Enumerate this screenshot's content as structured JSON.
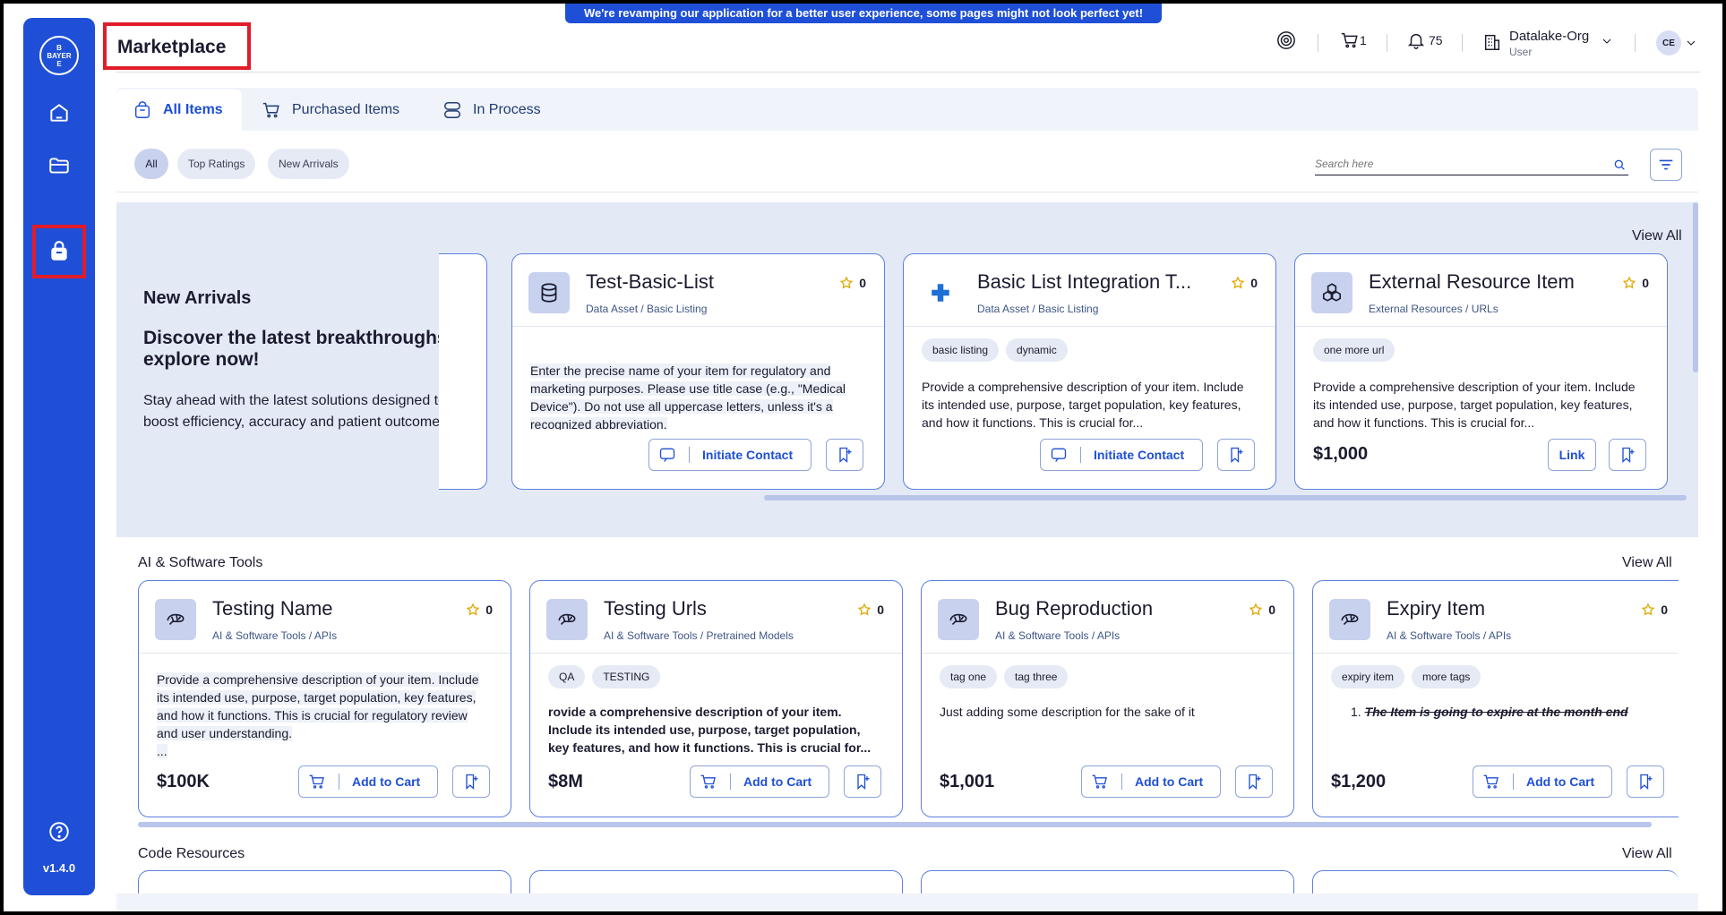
{
  "banner": "We're revamping our application for a better user experience, some pages might not look perfect yet!",
  "page_title": "Marketplace",
  "header": {
    "cart_count": "1",
    "notifications_count": "75",
    "org_name": "Datalake-Org",
    "org_role": "User",
    "avatar_initials": "CE"
  },
  "logo_text": [
    "BAYER",
    "B",
    "E"
  ],
  "sidebar_version": "v1.4.0",
  "tabs": [
    {
      "label": "All Items"
    },
    {
      "label": "Purchased Items"
    },
    {
      "label": "In Process"
    }
  ],
  "filters": {
    "chips": [
      "All",
      "Top Ratings",
      "New Arrivals"
    ],
    "search_placeholder": "Search here"
  },
  "new_arrivals": {
    "title": "New Arrivals",
    "headline": "Discover the latest breakthroughs, explore now!",
    "text": "Stay ahead with the latest solutions designed to boost efficiency, accuracy and patient outcomes.",
    "view_all": "View All",
    "cards": [
      {
        "title": "Test-Basic-List",
        "subtitle": "Data Asset / Basic Listing",
        "rating": "0",
        "description": "Enter the precise name of your item for regulatory and marketing purposes. Please use title case (e.g., \"Medical Device\"). Do not use all uppercase letters, unless it's a recognized abbreviation.",
        "action": "Initiate Contact"
      },
      {
        "title": "Basic List Integration T...",
        "subtitle": "Data Asset / Basic Listing",
        "rating": "0",
        "tags": [
          "basic listing",
          "dynamic"
        ],
        "description": "Provide a comprehensive description of your item. Include its intended use, purpose, target population, key features, and how it functions. This is crucial for...",
        "action": "Initiate Contact"
      },
      {
        "title": "External Resource Item",
        "subtitle": "External Resources / URLs",
        "rating": "0",
        "tags": [
          "one more url"
        ],
        "description": "Provide a comprehensive description of your item. Include its intended use, purpose, target population, key features, and how it functions. This is crucial for...",
        "price": "$1,000",
        "action": "Link"
      }
    ]
  },
  "ai_tools": {
    "title": "AI & Software Tools",
    "view_all": "View All",
    "cards": [
      {
        "title": "Testing Name",
        "subtitle": "AI & Software Tools / APIs",
        "rating": "0",
        "description": "Provide a comprehensive description of your item. Include its intended use, purpose, target population, key features, and how it functions. This is crucial for regulatory review and user understanding.",
        "ellipsis": "...",
        "price": "$100K",
        "action": "Add to Cart"
      },
      {
        "title": "Testing Urls",
        "subtitle": "AI & Software Tools / Pretrained Models",
        "rating": "0",
        "tags": [
          "QA",
          "TESTING"
        ],
        "description": "rovide a comprehensive description of your item. Include its intended use, purpose, target population, key features, and how it functions. This is crucial for...",
        "price": "$8M",
        "action": "Add to Cart"
      },
      {
        "title": "Bug Reproduction",
        "subtitle": "AI & Software Tools / APIs",
        "rating": "0",
        "tags": [
          "tag one",
          "tag three"
        ],
        "description": "Just adding some description for the sake of it",
        "price": "$1,001",
        "action": "Add to Cart"
      },
      {
        "title": "Expiry Item",
        "subtitle": "AI & Software Tools / APIs",
        "rating": "0",
        "tags": [
          "expiry item",
          "more tags"
        ],
        "list_item": "The Item is going to expire at the month end",
        "price": "$1,200",
        "action": "Add to Cart"
      }
    ]
  },
  "code_resources": {
    "title": "Code Resources",
    "view_all": "View All"
  }
}
